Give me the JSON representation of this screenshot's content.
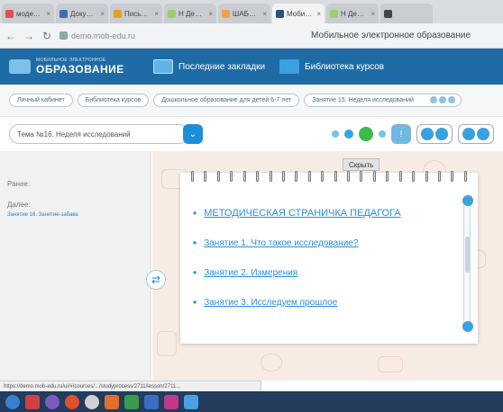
{
  "browser": {
    "tabs": [
      {
        "label": "модели НО",
        "color": "#e05050"
      },
      {
        "label": "Документ",
        "color": "#3a6fb5"
      },
      {
        "label": "Письмо - Ц",
        "color": "#e8a020"
      },
      {
        "label": "Н Демо-до",
        "color": "#9ad06a"
      },
      {
        "label": "ШАБЛОН д",
        "color": "#f0a050"
      },
      {
        "label": "Мобильн",
        "color": "#2a5080",
        "active": true
      },
      {
        "label": "Н Демо-до",
        "color": "#9ad06a"
      },
      {
        "label": "",
        "color": "#444"
      }
    ],
    "back_icon": "back-arrow-icon",
    "forward_icon": "forward-arrow-icon",
    "reload_icon": "reload-icon",
    "url": "demo.mob-edu.ru",
    "page_title": "Мобильное электронное образование"
  },
  "header": {
    "logo_small": "МОБИЛЬНОЕ ЭЛЕКТРОННОЕ",
    "logo_big": "ОБРАЗОВАНИЕ",
    "bookmarks_label": "Последние закладки",
    "library_label": "Библиотека курсов"
  },
  "breadcrumbs": [
    "Личный кабинет",
    "Библиотека курсов",
    "Дошкольное образование для детей 6-7 лет",
    "Занятие 15. Неделя исследований"
  ],
  "toolbar": {
    "topic_select": "Тема №16. Неделя исследований"
  },
  "sidebar": {
    "prev_label": "Ранее:",
    "next_label": "Далее:",
    "next_link": "Занятие 16. Занятие-забава"
  },
  "content": {
    "hide_button": "Скрыть",
    "items": [
      "МЕТОДИЧЕСКАЯ СТРАНИЧКА ПЕДАГОГА",
      "Занятие 1. Что такое исследование?",
      "Занятие 2. Измерения",
      "Занятие 3. Исследуем прошлое"
    ]
  },
  "status_url": "https://demo.mob-edu.ru/ui/#/courses/.../studyprocess/2711/lesson/2711...",
  "colors": {
    "header_bg": "#1f6ba5",
    "accent": "#1a8fd8",
    "active_step": "#3cba4a",
    "canvas_bg": "#f7ece4"
  }
}
